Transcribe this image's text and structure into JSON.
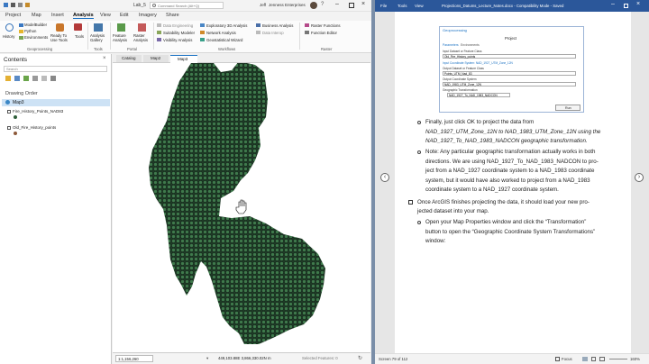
{
  "arcgis": {
    "title": "Lab_5",
    "command_search_placeholder": "Command Search (Alt+Q)",
    "user": "Jeff",
    "org": "Jenness Enterprises",
    "tabs": [
      "Project",
      "Map",
      "Insert",
      "Analysis",
      "View",
      "Edit",
      "Imagery",
      "Share"
    ],
    "selected_tab": "Analysis",
    "ribbon": {
      "history": "History",
      "modelbuilder": "ModelBuilder",
      "python": "Python",
      "environments": "Environments",
      "ready_to_use": "Ready To Use Tools",
      "tools": "Tools",
      "analysis_gallery": "Analysis Gallery",
      "feature_analysis": "Feature Analysis",
      "raster_analysis": "Raster Analysis",
      "data_engineering": "Data Engineering",
      "suitability_modeler": "Suitability Modeler",
      "visibility_analysis": "Visibility Analysis",
      "exploratory_3d": "Exploratory 3D Analysis",
      "network_analysis": "Network Analysis",
      "geostatistical_wizard": "Geostatistical Wizard",
      "business_analysis": "Business Analysis",
      "data_interop": "Data Interop",
      "raster_functions": "Raster Functions",
      "function_editor": "Function Editor",
      "groups": [
        "Geoprocessing",
        "Tools",
        "Portal",
        "Workflows",
        "Raster"
      ]
    },
    "contents": {
      "title": "Contents",
      "search_placeholder": "Search",
      "drawing_order": "Drawing Order",
      "map_name": "Map3",
      "layers": [
        "Fire_History_Points_NAD83",
        "Old_Fire_History_points"
      ]
    },
    "map_tabs": [
      "Catalog",
      "Map2",
      "Map3"
    ],
    "scale": "1:1,156,260",
    "coordinates": "449,103.88E 3,866,330.02N m",
    "selected_features": "Selected Features: 0"
  },
  "word": {
    "title": "Projections_Datums_Lecture_Notes.docx - Compatibility Mode - Saved",
    "tabs": [
      "File",
      "Tools",
      "View"
    ],
    "dialog": {
      "header": "Geoprocessing",
      "tool": "Project",
      "tabs": [
        "Parameters",
        "Environments"
      ],
      "fields": [
        {
          "label": "Input Dataset or Feature Class",
          "value": "Old_Fire_History_points"
        },
        {
          "label": "Input Coordinate System: NAD_1927_UTM_Zone_12N",
          "value": ""
        },
        {
          "label": "Output Dataset or Feature Class",
          "value": "Points_UTM_Nad_83"
        },
        {
          "label": "Output Coordinate System",
          "value": "NAD_1983_UTM_Zone_12N"
        },
        {
          "label": "Geographic Transformation",
          "value": "NAD_1927_To_NAD_1983_NADCON"
        }
      ],
      "run": "Run"
    },
    "paragraphs": {
      "p1a": "Finally, just click OK to project the data from",
      "p1b": "NAD_1927_UTM_Zone_12N to NAD_1983_UTM_Zone_12N using the",
      "p1c": "NAD_1927_To_NAD_1983_NADCON geographic transformation.",
      "p2a": "Note: Any particular geographic transformation actually works in both",
      "p2b": "directions. We are using NAD_1927_To_NAD_1983_NADCON to pro-",
      "p2c": "ject from a NAD_1927 coordinate system to a NAD_1983 coordinate",
      "p2d": "system, but it would have also worked to project from a NAD_1983",
      "p2e": "coordinate system to a NAD_1927 coordinate system.",
      "p3a": "Once ArcGIS finishes projecting the data, it should load your new pro-",
      "p3b": "jected dataset into your map.",
      "p4a": "Open your Map Properties window and click the “Transformation”",
      "p4b": "button to open the “Geographic Coordinate System Transformations”",
      "p4c": "window:"
    },
    "status": "Screen 79 of 112",
    "focus": "Focus",
    "zoom": "160%"
  },
  "colors": {
    "word_blue": "#2b579a",
    "point_green": "#2f5e3a",
    "arc_blue": "#1c72c3"
  }
}
